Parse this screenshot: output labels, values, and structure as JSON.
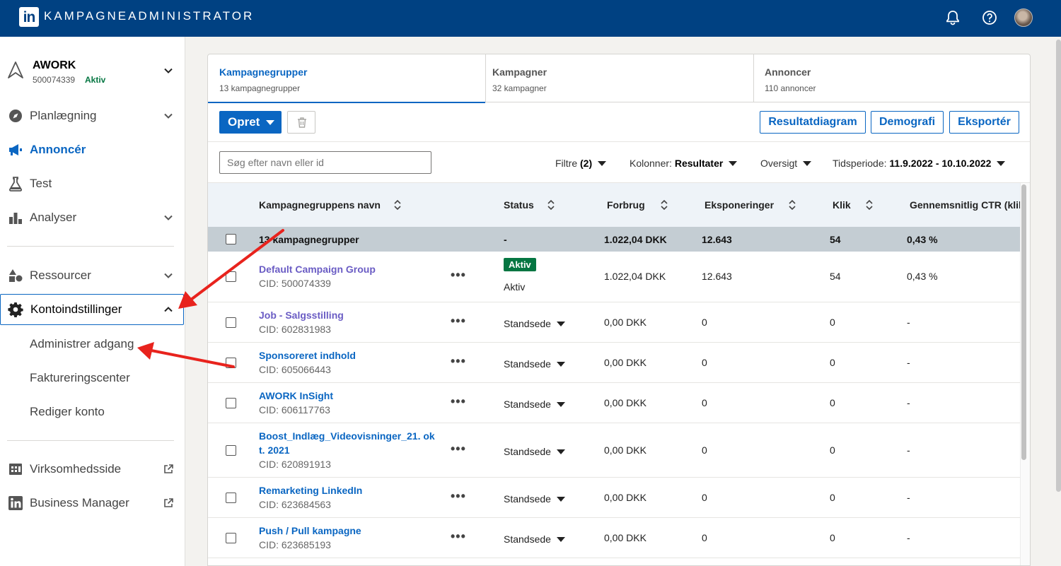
{
  "app": {
    "title": "KAMPAGNEADMINISTRATOR",
    "logo_text": "in",
    "icons": [
      "bell-icon",
      "help-icon",
      "avatar"
    ]
  },
  "sidebar": {
    "account": {
      "name": "AWORK",
      "id": "500074339",
      "status": "Aktiv"
    },
    "items": [
      {
        "label": "Planlægning",
        "icon": "compass-icon"
      },
      {
        "label": "Annoncér",
        "icon": "megaphone-icon"
      },
      {
        "label": "Test",
        "icon": "flask-icon"
      },
      {
        "label": "Analyser",
        "icon": "bar-chart-icon"
      },
      {
        "label": "Ressourcer",
        "icon": "shapes-icon"
      },
      {
        "label": "Kontoindstillinger",
        "icon": "gear-icon"
      }
    ],
    "sub_items": [
      "Administrer adgang",
      "Faktureringscenter",
      "Rediger konto"
    ],
    "external": [
      {
        "label": "Virksomhedsside",
        "icon": "building-icon"
      },
      {
        "label": "Business Manager",
        "icon": "linkedin-icon"
      }
    ]
  },
  "tabs": [
    {
      "label": "Kampagnegrupper",
      "sub": "13 kampagnegrupper"
    },
    {
      "label": "Kampagner",
      "sub": "32 kampagner"
    },
    {
      "label": "Annoncer",
      "sub": "110 annoncer"
    }
  ],
  "toolbar": {
    "create": "Opret",
    "result_chart": "Resultatdiagram",
    "demographics": "Demografi",
    "export": "Eksportér"
  },
  "filters": {
    "search_placeholder": "Søg efter navn eller id",
    "filter_label": "Filtre",
    "filter_count": "(2)",
    "columns_label": "Kolonner:",
    "columns_value": "Resultater",
    "overview": "Oversigt",
    "period_label": "Tidsperiode:",
    "period_value": "11.9.2022 - 10.10.2022"
  },
  "table": {
    "headers": [
      "Kampagnegruppens navn",
      "Status",
      "Forbrug",
      "Eksponeringer",
      "Klik",
      "Gennemsnitlig CTR (klik)"
    ],
    "summary": {
      "name": "13 kampagnegrupper",
      "status": "-",
      "spend": "1.022,04 DKK",
      "impressions": "12.643",
      "clicks": "54",
      "ctr": "0,43 %"
    },
    "rows": [
      {
        "name": "Default Campaign Group",
        "cid": "CID: 500074339",
        "badge": "Aktiv",
        "status": "Aktiv",
        "spend": "1.022,04 DKK",
        "impressions": "12.643",
        "clicks": "54",
        "ctr": "0,43 %"
      },
      {
        "name": "Job - Salgsstilling",
        "cid": "CID: 602831983",
        "status": "Standsede",
        "spend": "0,00 DKK",
        "impressions": "0",
        "clicks": "0",
        "ctr": "-"
      },
      {
        "name": "Sponsoreret indhold",
        "cid": "CID: 605066443",
        "status": "Standsede",
        "spend": "0,00 DKK",
        "impressions": "0",
        "clicks": "0",
        "ctr": "-"
      },
      {
        "name": "AWORK InSight",
        "cid": "CID: 606117763",
        "status": "Standsede",
        "spend": "0,00 DKK",
        "impressions": "0",
        "clicks": "0",
        "ctr": "-"
      },
      {
        "name_line1": "Boost_Indlæg_Videovisninger_21. ok",
        "name_line2": "t. 2021",
        "cid": "CID: 620891913",
        "status": "Standsede",
        "spend": "0,00 DKK",
        "impressions": "0",
        "clicks": "0",
        "ctr": "-"
      },
      {
        "name": "Remarketing LinkedIn",
        "cid": "CID: 623684563",
        "status": "Standsede",
        "spend": "0,00 DKK",
        "impressions": "0",
        "clicks": "0",
        "ctr": "-"
      },
      {
        "name": "Push / Pull kampagne",
        "cid": "CID: 623685193",
        "status": "Standsede",
        "spend": "0,00 DKK",
        "impressions": "0",
        "clicks": "0",
        "ctr": "-"
      }
    ],
    "row_menu": "•••"
  },
  "colors": {
    "brand": "#004182",
    "accent": "#0a66c2",
    "active": "#057642",
    "arrow": "#e8231d"
  }
}
